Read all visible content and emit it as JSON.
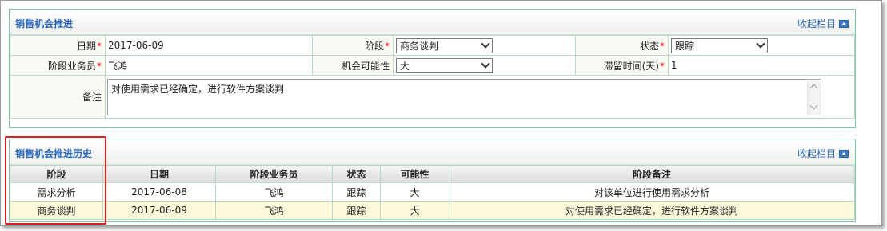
{
  "panel1": {
    "title": "销售机会推进",
    "collapse_label": "收起栏目",
    "fields": {
      "date": {
        "label": "日期",
        "value": "2017-06-09"
      },
      "stage": {
        "label": "阶段",
        "value": "商务谈判"
      },
      "status": {
        "label": "状态",
        "value": "跟踪"
      },
      "stage_owner": {
        "label": "阶段业务员",
        "value": "飞鸿"
      },
      "probability": {
        "label": "机会可能性",
        "value": "大"
      },
      "stay_time": {
        "label": "滞留时间(天)",
        "value": "1"
      },
      "remark": {
        "label": "备注",
        "value": "对使用需求已经确定，进行软件方案谈判"
      }
    }
  },
  "panel2": {
    "title": "销售机会推进历史",
    "collapse_label": "收起栏目",
    "columns": [
      "阶段",
      "日期",
      "阶段业务员",
      "状态",
      "可能性",
      "阶段备注"
    ],
    "rows": [
      [
        "需求分析",
        "2017-06-08",
        "飞鸿",
        "跟踪",
        "大",
        "对该单位进行使用需求分析"
      ],
      [
        "商务谈判",
        "2017-06-09",
        "飞鸿",
        "跟踪",
        "大",
        "对使用需求已经确定，进行软件方案谈判"
      ]
    ]
  },
  "colors": {
    "accent_title": "#2a66b8",
    "panel_border": "#7fc7a0",
    "required_mark": "#e00000",
    "highlight_box": "#e02020",
    "row_alt": "#fbf9d9"
  }
}
